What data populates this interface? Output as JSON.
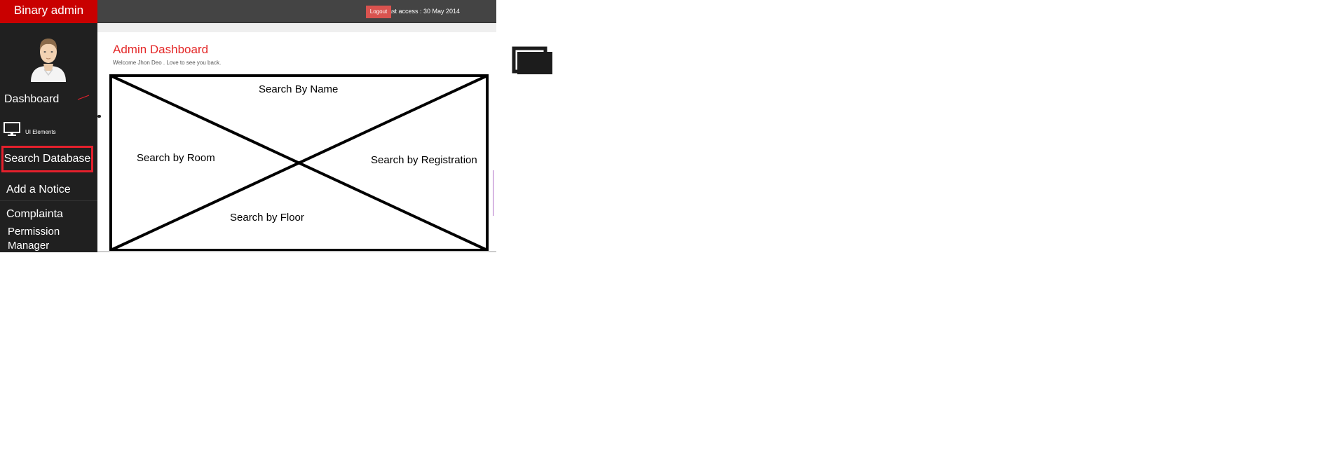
{
  "brand": {
    "title": "Binary admin",
    "color": "#c90000"
  },
  "topbar": {
    "last_access": "Last access : 30 May 2014",
    "logout_label": "Logout",
    "logout_color": "#d9534f"
  },
  "sidebar": {
    "avatar_icon": "user-avatar-icon",
    "items": [
      {
        "label": "Dashboard"
      },
      {
        "label": "UI Elements",
        "icon": "monitor-icon"
      },
      {
        "label": "Search Database",
        "highlight_color": "#e4202c"
      },
      {
        "label": "Add a Notice"
      },
      {
        "label": "Complainta"
      },
      {
        "label": "Permission Manager"
      }
    ]
  },
  "main": {
    "title": "Admin Dashboard",
    "title_color": "#e42828",
    "subtitle": "Welcome Jhon Deo . Love to see you back.",
    "wireframe": {
      "top": "Search By Name",
      "left": "Search by Room",
      "right": "Search by Registration",
      "bottom": "Search by  Floor"
    }
  },
  "floating_icon": "window-stack-icon"
}
